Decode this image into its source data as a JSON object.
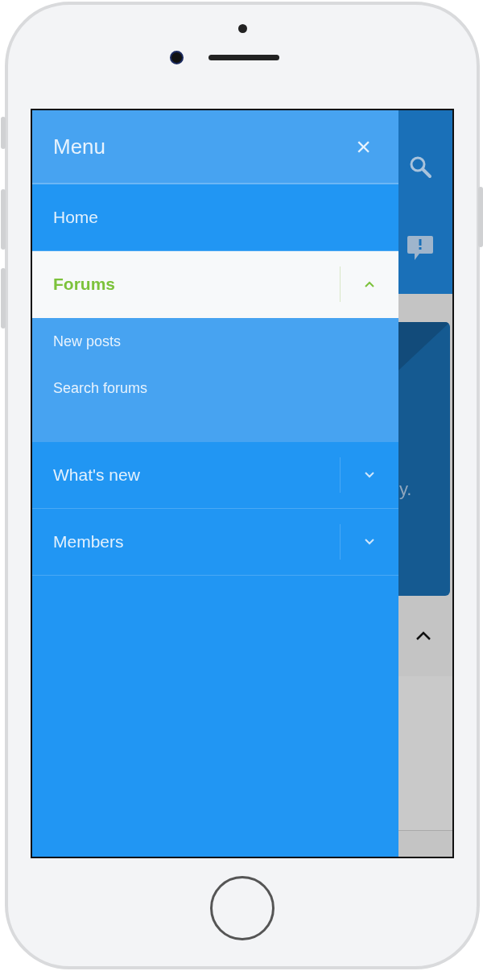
{
  "menu": {
    "title": "Menu",
    "close": "×"
  },
  "items": [
    {
      "kind": "link",
      "label": "Home",
      "selected": false
    },
    {
      "kind": "expandable",
      "label": "Forums",
      "selected": true,
      "expanded": true,
      "children": [
        {
          "label": "New posts"
        },
        {
          "label": "Search forums"
        }
      ]
    },
    {
      "kind": "expandable",
      "label": "What's new",
      "selected": false,
      "expanded": false
    },
    {
      "kind": "expandable",
      "label": "Members",
      "selected": false,
      "expanded": false
    }
  ],
  "background_page": {
    "card_text": "y."
  }
}
